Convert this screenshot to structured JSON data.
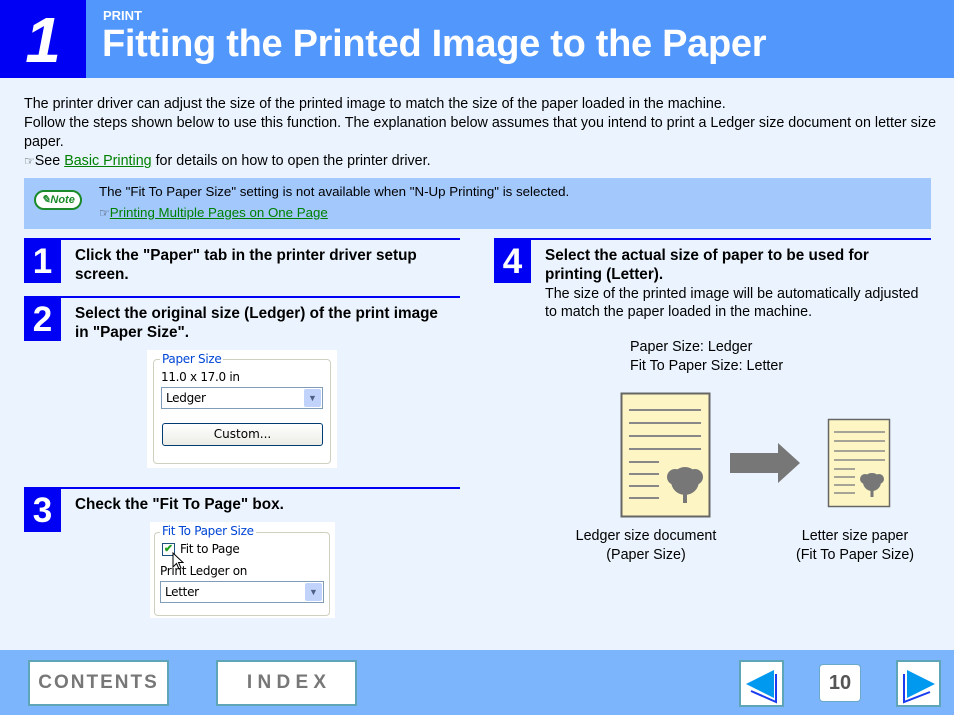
{
  "header": {
    "chapter_number": "1",
    "section_label": "PRINT",
    "title": "Fitting the Printed Image to the Paper"
  },
  "intro": {
    "line1": "The printer driver can adjust the size of the printed image to match the size of the paper loaded in the machine.",
    "line2": "Follow the steps shown below to use this function. The explanation below assumes that you intend to print a Ledger size document on letter size paper.",
    "see_prefix": "See ",
    "see_link": "Basic Printing",
    "see_suffix": " for details on how to open the printer driver.",
    "hand_icon": "☞"
  },
  "note": {
    "badge_label": "Note",
    "text": "The \"Fit To Paper Size\" setting is not available when \"N-Up Printing\" is selected.",
    "link": "Printing Multiple Pages on One Page",
    "hand_icon": "☞"
  },
  "steps": [
    {
      "number": "1",
      "title": "Click the \"Paper\" tab in the printer driver setup screen."
    },
    {
      "number": "2",
      "title": "Select the original size (Ledger) of the print image in \"Paper Size\"."
    },
    {
      "number": "3",
      "title": "Check the \"Fit To Page\" box."
    },
    {
      "number": "4",
      "title": "Select the actual size of paper to be used for printing (Letter).",
      "description": "The size of the printed image will be automatically adjusted to match the paper loaded in the machine."
    }
  ],
  "dialog_paper_size": {
    "legend": "Paper Size",
    "dimensions": "11.0 x 17.0 in",
    "selected": "Ledger",
    "custom_button": "Custom..."
  },
  "dialog_fit": {
    "legend": "Fit To Paper Size",
    "checkbox_label": "Fit to Page",
    "checked": true,
    "print_on_label": "Print Ledger on",
    "selected": "Letter"
  },
  "figure": {
    "info_line1": "Paper Size: Ledger",
    "info_line2": "Fit To Paper Size: Letter",
    "left_caption1": "Ledger size document",
    "left_caption2": "(Paper Size)",
    "right_caption1": "Letter size paper",
    "right_caption2": "(Fit To Paper Size)"
  },
  "footer": {
    "contents_label": "CONTENTS",
    "index_label": "I N D E X",
    "page_number": "10"
  },
  "colors": {
    "header_bg": "#5297fc",
    "chapter_box": "#0000f5",
    "page_bg": "#ebf4fe",
    "note_bg": "#a3c8fc",
    "link": "#008000",
    "footer_bg": "#7db5fd"
  }
}
